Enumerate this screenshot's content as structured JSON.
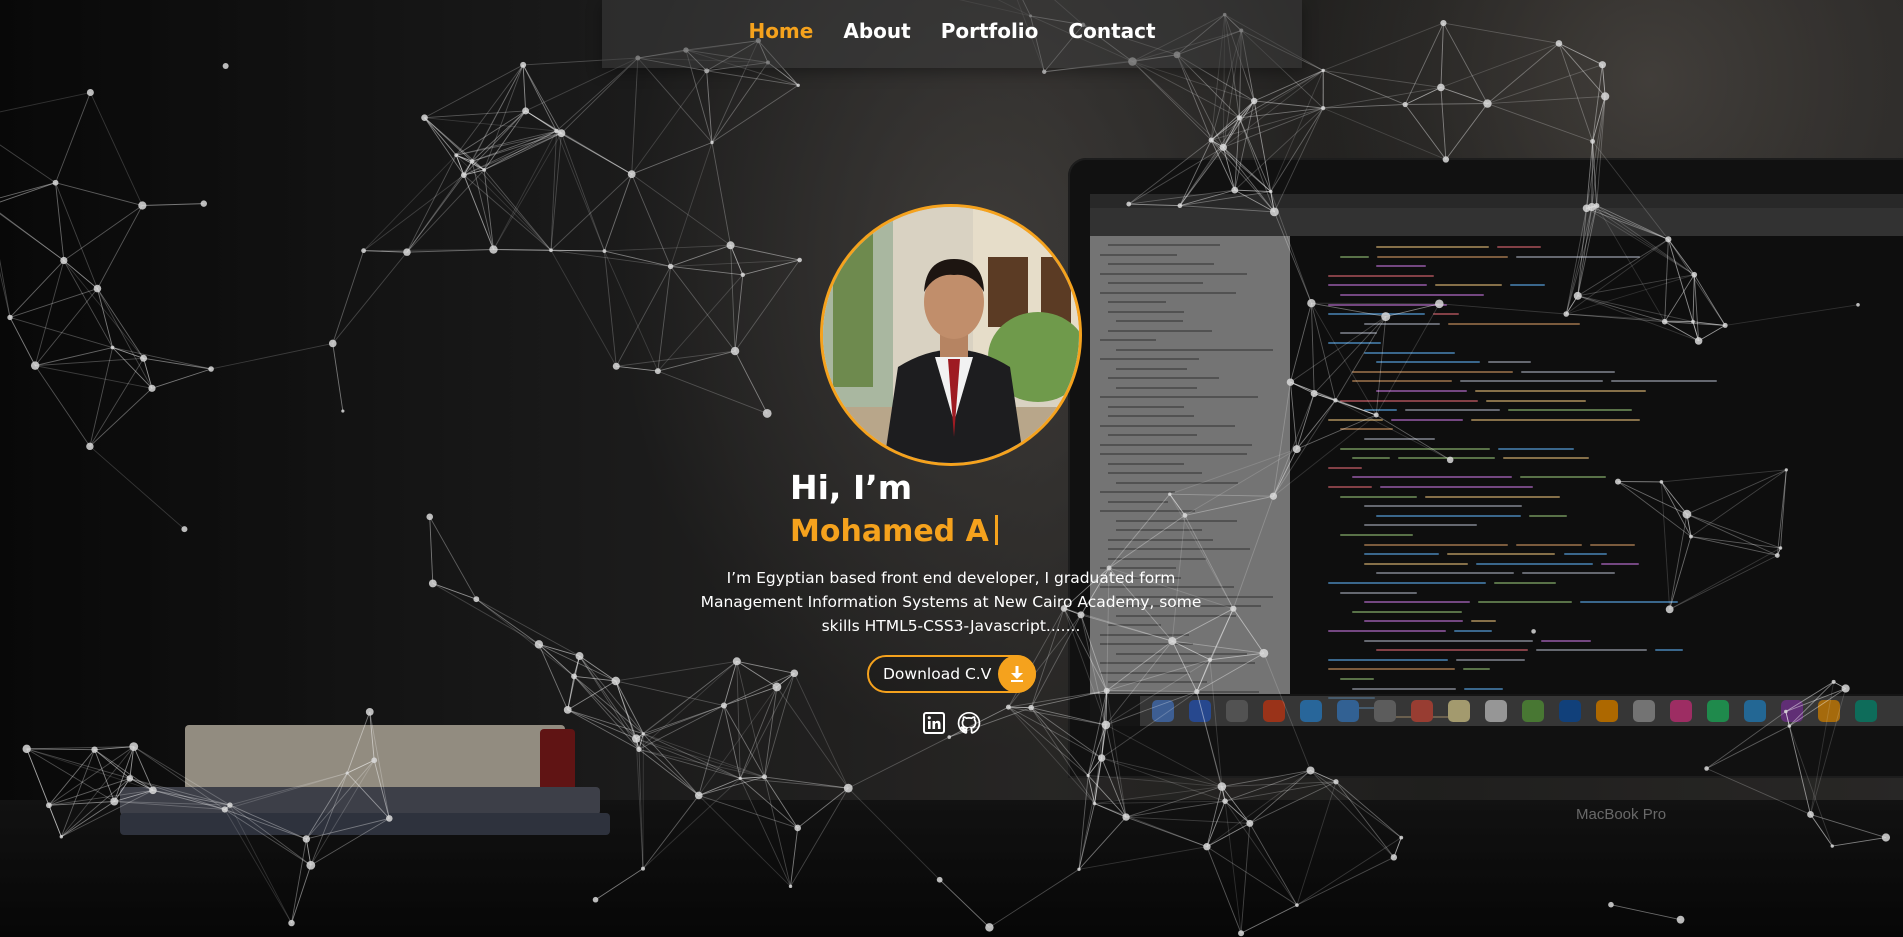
{
  "nav": {
    "items": [
      {
        "label": "Home",
        "active": true
      },
      {
        "label": "About",
        "active": false
      },
      {
        "label": "Portfolio",
        "active": false
      },
      {
        "label": "Contact",
        "active": false
      }
    ]
  },
  "hero": {
    "greeting": "Hi, I’m",
    "name": "Mohamed A",
    "description": "I’m Egyptian based front end developer, I graduated form Management Information Systems at New Cairo Academy, some skills HTML5-CSS3-Javascript.......",
    "cv_button_label": "Download C.V",
    "cv_button_icon": "download-icon",
    "social": [
      {
        "icon": "linkedin-icon"
      },
      {
        "icon": "github-icon"
      }
    ]
  },
  "background": {
    "laptop_brand": "MacBook Pro"
  },
  "colors": {
    "accent": "#f5a21d",
    "text": "#ffffff",
    "nav_bg": "rgba(60,60,60,0.55)"
  }
}
